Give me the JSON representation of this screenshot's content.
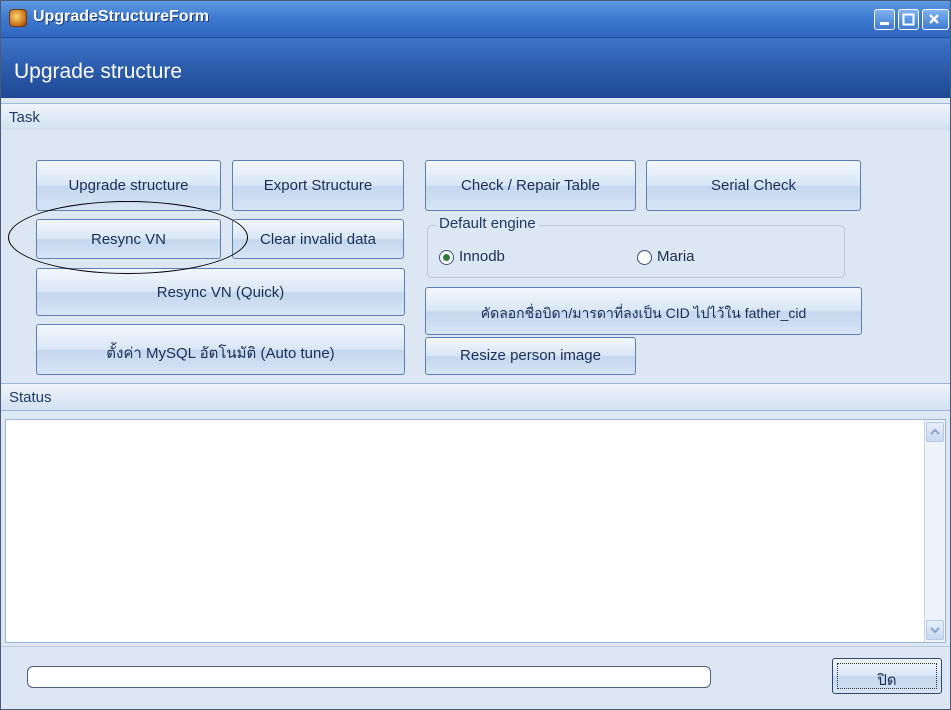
{
  "window": {
    "title": "UpgradeStructureForm",
    "header_title": "Upgrade structure"
  },
  "task_section": {
    "label": "Task",
    "buttons": {
      "upgrade_structure": "Upgrade structure",
      "export_structure": "Export Structure",
      "check_repair_table": "Check / Repair Table",
      "serial_check": "Serial Check",
      "resync_vn": "Resync VN",
      "clear_invalid_data": "Clear invalid data",
      "resync_vn_quick": "Resync VN (Quick)",
      "copy_father_name": "คัดลอกชื่อบิดา/มารดาที่ลงเป็น CID ไปไว้ใน father_cid",
      "mysql_auto_tune": "ตั้งค่า MySQL อัตโนมัติ (Auto tune)",
      "resize_person_image": "Resize person image"
    },
    "default_engine": {
      "label": "Default engine",
      "options": [
        "Innodb",
        "Maria"
      ],
      "selected": "Innodb"
    }
  },
  "status_section": {
    "label": "Status",
    "text": ""
  },
  "progress": {
    "value": 0
  },
  "close_button": "ปิด",
  "colors": {
    "title_bar": "#3f7bd1",
    "header_band": "#2a5aa9",
    "panel": "#dce7f3",
    "button_border": "#5d7fb3"
  }
}
